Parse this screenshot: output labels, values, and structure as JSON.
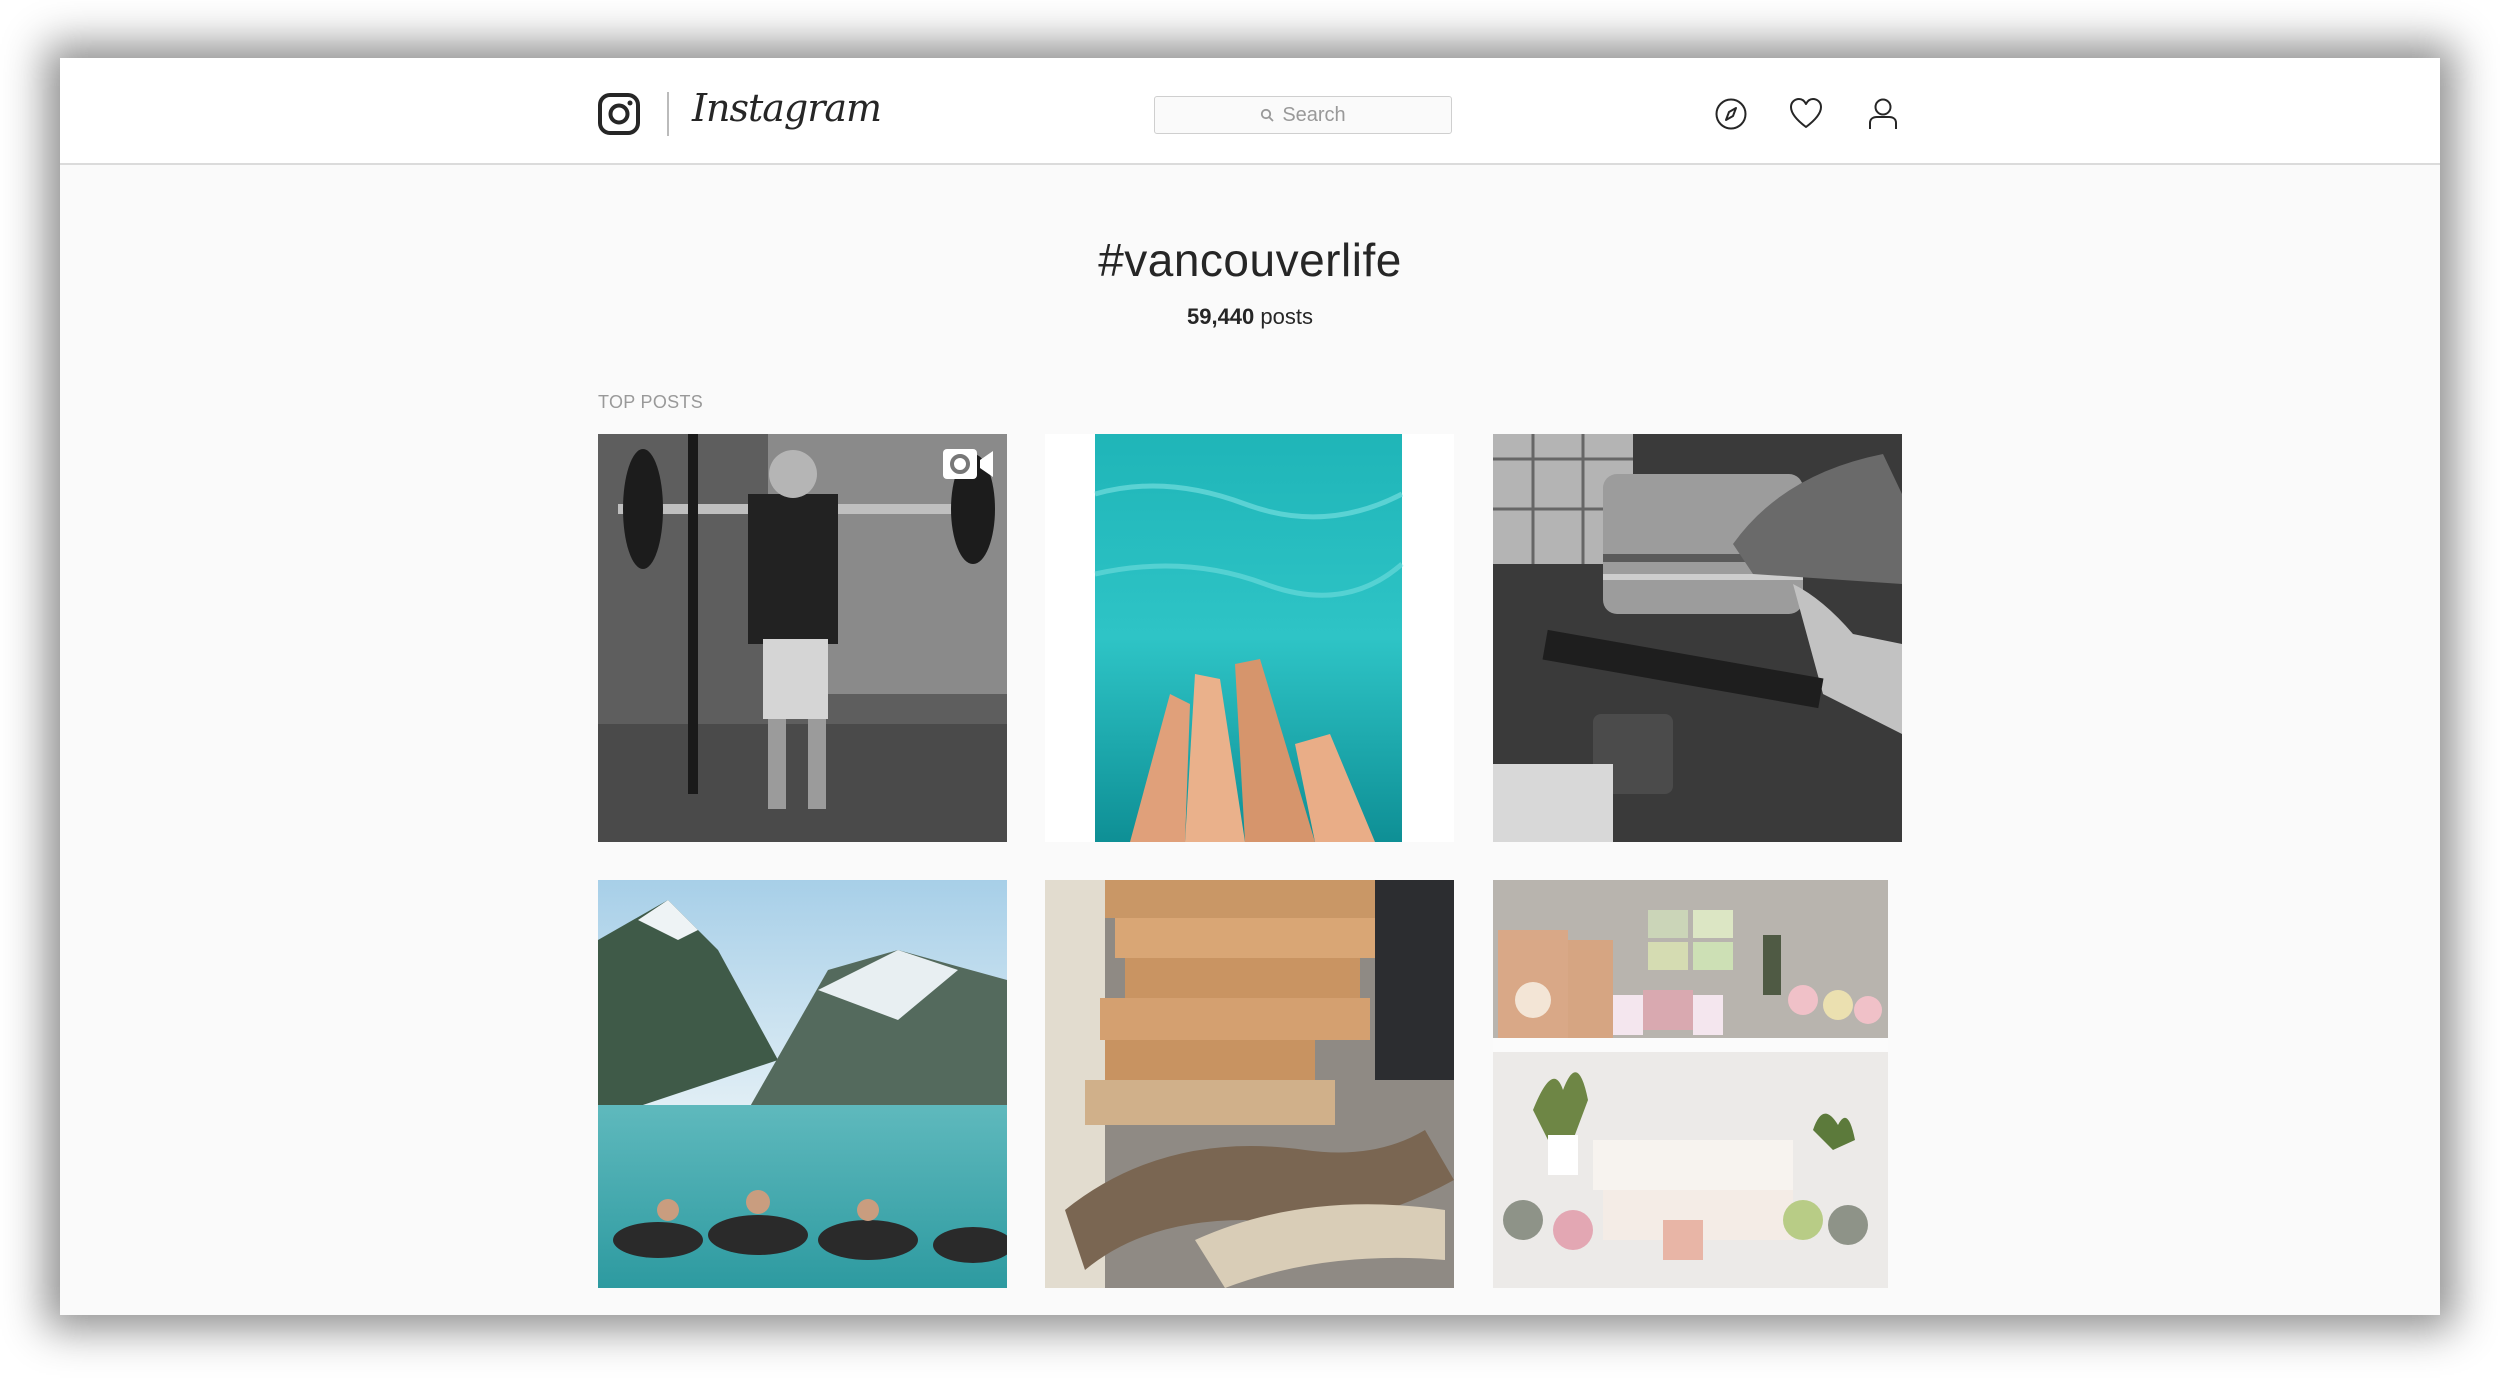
{
  "header": {
    "brand": "Instagram",
    "search_placeholder": "Search",
    "icons": [
      "compass-icon",
      "heart-icon",
      "user-icon"
    ]
  },
  "hashtag": {
    "title": "#vancouverlife",
    "post_count": "59,440",
    "post_count_suffix": "posts"
  },
  "section": {
    "label": "TOP POSTS"
  },
  "posts": [
    {
      "description": "Black and white photo of a person lifting a barbell in a gym",
      "is_video": true
    },
    {
      "description": "Legs dangling in turquoise pool water",
      "is_video": false
    },
    {
      "description": "Black and white photo of a man in a cap",
      "is_video": false
    },
    {
      "description": "People floating on tubes in a mountain lake",
      "is_video": false
    },
    {
      "description": "Stacked wooden boards and driftwood",
      "is_video": false
    },
    {
      "description": "Shelves with skincare products",
      "is_video": false
    }
  ],
  "colors": {
    "text": "#262626",
    "muted": "#999999",
    "border": "#dbdbdb",
    "background": "#fafafa"
  }
}
